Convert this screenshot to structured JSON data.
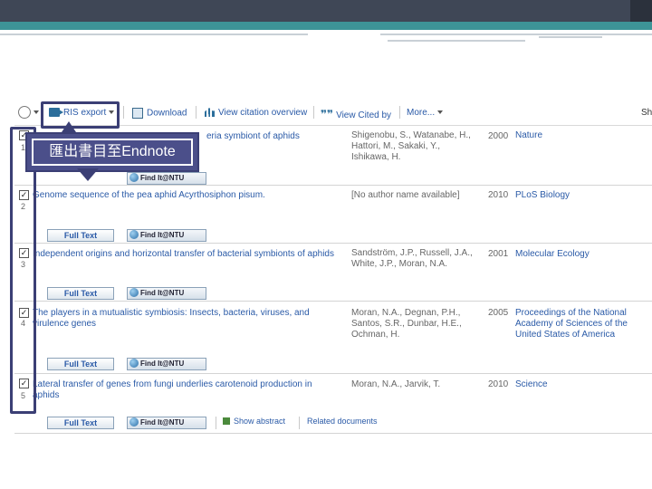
{
  "toolbar": {
    "ris_export": "RIS export",
    "download": "Download",
    "view_citation_overview": "View citation overview",
    "view_cited_by": "View Cited by",
    "more": "More...",
    "sh": "Sh"
  },
  "callout": {
    "text": "匯出書目至Endnote"
  },
  "buttons": {
    "full_text": "Full Text",
    "find_it": "Find It@NTU"
  },
  "results": [
    {
      "number": "1",
      "title": "eria symbiont of aphids",
      "authors": "Shigenobu, S., Watanabe, H., Hattori, M., Sakaki, Y., Ishikawa, H.",
      "year": "2000",
      "journal": "Nature"
    },
    {
      "number": "2",
      "title": "Genome sequence of the pea aphid Acyrthosiphon pisum.",
      "authors": "[No author name available]",
      "year": "2010",
      "journal": "PLoS Biology"
    },
    {
      "number": "3",
      "title": "Independent origins and horizontal transfer of bacterial symbionts of aphids",
      "authors": "Sandström, J.P., Russell, J.A., White, J.P., Moran, N.A.",
      "year": "2001",
      "journal": "Molecular Ecology"
    },
    {
      "number": "4",
      "title": "The players in a mutualistic symbiosis: Insects, bacteria, viruses, and virulence genes",
      "authors": "Moran, N.A., Degnan, P.H., Santos, S.R., Dunbar, H.E., Ochman, H.",
      "year": "2005",
      "journal": "Proceedings of the National Academy of Sciences of the United States of America"
    },
    {
      "number": "5",
      "title": "Lateral transfer of genes from fungi underlies carotenoid production in aphids",
      "authors": "Moran, N.A., Jarvik, T.",
      "year": "2010",
      "journal": "Science"
    }
  ],
  "last_row_links": {
    "show_abstract": "Show abstract",
    "related_documents": "Related documents"
  },
  "colors": {
    "link": "#2a5aa7",
    "annotation": "#3b3f75",
    "header": "#3f4756",
    "teal": "#3d9497"
  },
  "icons": [
    "select-all-icon",
    "ris-export-icon",
    "download-icon",
    "citation-overview-icon",
    "cited-by-icon",
    "globe-icon",
    "abstract-icon"
  ]
}
